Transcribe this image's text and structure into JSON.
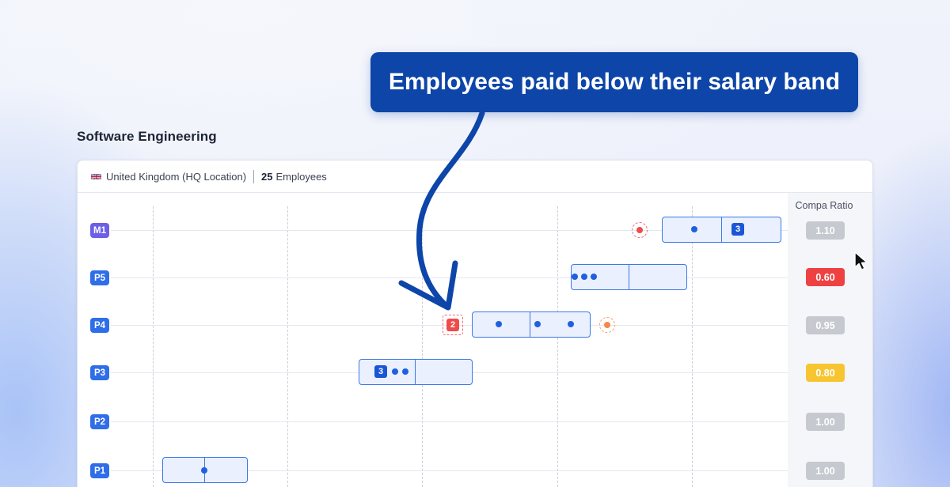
{
  "callout": {
    "text": "Employees paid below their salary band"
  },
  "section": {
    "title": "Software Engineering"
  },
  "card": {
    "location": "United Kingdom (HQ Location)",
    "employee_count": "25",
    "employee_label": "Employees",
    "compa_header": "Compa Ratio"
  },
  "rows": [
    {
      "level": "M1",
      "badge": "3",
      "compa": "1.10"
    },
    {
      "level": "P5",
      "compa": "0.60"
    },
    {
      "level": "P4",
      "badge": "2",
      "compa": "0.95"
    },
    {
      "level": "P3",
      "badge": "3",
      "compa": "0.80"
    },
    {
      "level": "P2",
      "compa": "1.00"
    },
    {
      "level": "P1",
      "compa": "1.00"
    }
  ],
  "colors": {
    "brand": "#0d45a8",
    "band_border": "#3b78e8",
    "dot": "#1f5fe0",
    "ratio_low": "#ee4242",
    "ratio_warn": "#f7c531",
    "ratio_neutral": "#c6c9cf",
    "outlier_red": "#ee4b4b",
    "outlier_orange": "#f28a4b"
  },
  "icons": {
    "flag": "uk-flag-icon",
    "cursor": "mouse-pointer-icon",
    "annotation": "curved-arrow-icon"
  }
}
